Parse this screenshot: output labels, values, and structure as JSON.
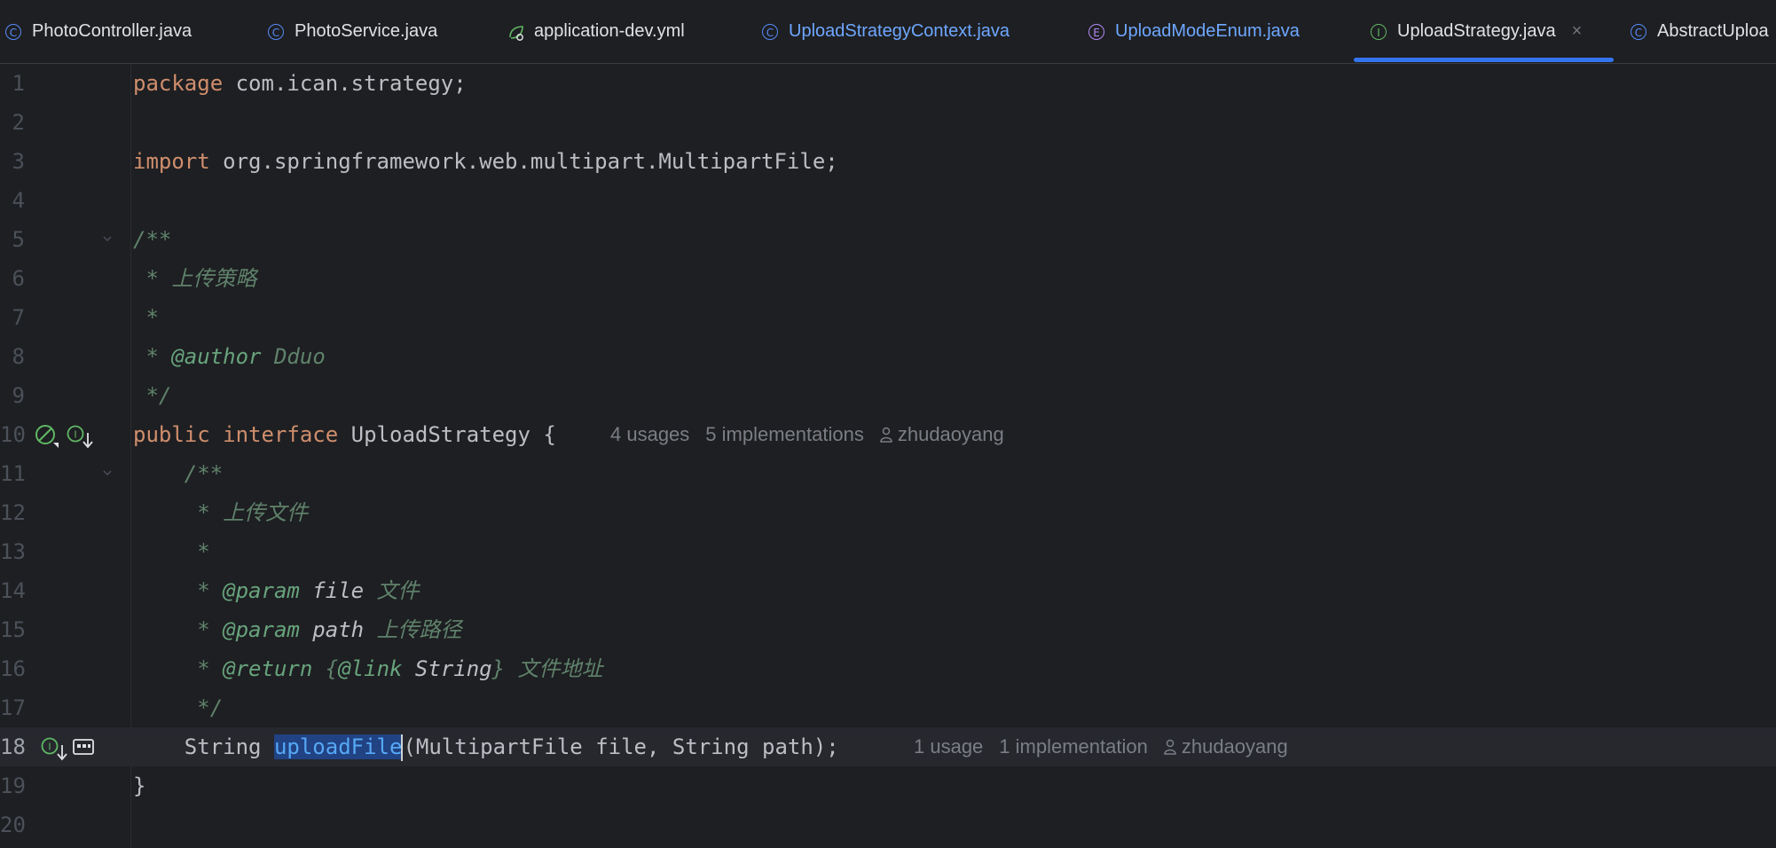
{
  "tabs": [
    {
      "label": "PhotoController.java",
      "icon": "class-icon",
      "kind": "class",
      "color": "normal"
    },
    {
      "label": "PhotoService.java",
      "icon": "class-icon",
      "kind": "class",
      "color": "normal"
    },
    {
      "label": "application-dev.yml",
      "icon": "yml-icon",
      "kind": "yml",
      "color": "normal"
    },
    {
      "label": "UploadStrategyContext.java",
      "icon": "class-icon",
      "kind": "class",
      "color": "blue"
    },
    {
      "label": "UploadModeEnum.java",
      "icon": "enum-icon",
      "kind": "enum",
      "color": "blue"
    },
    {
      "label": "UploadStrategy.java",
      "icon": "interface-icon",
      "kind": "iface",
      "color": "active",
      "close": "×"
    },
    {
      "label": "AbstractUploa",
      "icon": "class-icon",
      "kind": "class",
      "color": "normal"
    }
  ],
  "tab_icon_letters": {
    "class": "C",
    "iface": "I",
    "enum": "E"
  },
  "lines": [
    "1",
    "2",
    "3",
    "4",
    "5",
    "6",
    "7",
    "8",
    "9",
    "10",
    "11",
    "12",
    "13",
    "14",
    "15",
    "16",
    "17",
    "18",
    "19",
    "20"
  ],
  "code": {
    "l1_kw": "package",
    "l1_rest": " com.ican.strategy;",
    "l3_kw": "import",
    "l3_rest": " org.springframework.web.multipart.MultipartFile;",
    "l5": "/**",
    "l6": " * 上传策略",
    "l7": " *",
    "l8_a": " * ",
    "l8_tag": "@author",
    "l8_val": " Dduo",
    "l9": " */",
    "l10_kw1": "public",
    "l10_kw2": " interface",
    "l10_name": " UploadStrategy {",
    "l11": "    /**",
    "l12": "     * 上传文件",
    "l13": "     *",
    "l14_a": "     * ",
    "l14_tag": "@param",
    "l14_param": " file",
    "l14_desc": " 文件",
    "l15_a": "     * ",
    "l15_tag": "@param",
    "l15_param": " path",
    "l15_desc": " 上传路径",
    "l16_a": "     * ",
    "l16_tag": "@return",
    "l16_b": " {",
    "l16_link": "@link",
    "l16_type": " String",
    "l16_c": "}",
    "l16_desc": " 文件地址",
    "l17": "     */",
    "l18_a": "    String ",
    "l18_sel": "uploadFile",
    "l18_rest": "(MultipartFile file, String path);",
    "l19": "}"
  },
  "hints": {
    "l10_usages": "4 usages",
    "l10_impl": "5 implementations",
    "l10_author": "zhudaoyang",
    "l18_usages": "1 usage",
    "l18_impl": "1 implementation",
    "l18_author": "zhudaoyang"
  },
  "colors": {
    "accent": "#3574f0",
    "background": "#1e1f22",
    "keyword": "#cf8e6d",
    "comment": "#5f826b",
    "current_line": "#26282e"
  }
}
